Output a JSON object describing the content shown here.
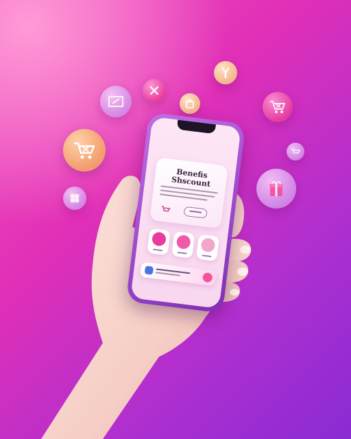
{
  "scene": {
    "background_colors": [
      "#f04fbf",
      "#e12fb7",
      "#b02fcf",
      "#8a2bd4"
    ],
    "floating_icons": [
      "shopping-cart-icon",
      "discount-tag-icon",
      "percent-icon",
      "gift-bag-icon",
      "shopping-bag-icon",
      "cart-icon",
      "gift-box-icon",
      "clover-icon",
      "small-cart-icon"
    ]
  },
  "phone": {
    "card": {
      "title": "Benefis\nShscount"
    },
    "tiles": [
      {
        "icon": "pink-bag-icon",
        "color": "#e83b9c"
      },
      {
        "icon": "gift-icon",
        "color": "#f05aa8"
      },
      {
        "icon": "profile-avatar-icon",
        "color": "#f2a6c9"
      }
    ],
    "banner": {
      "icon": "app-badge-icon",
      "accent": "#f2559f"
    }
  }
}
